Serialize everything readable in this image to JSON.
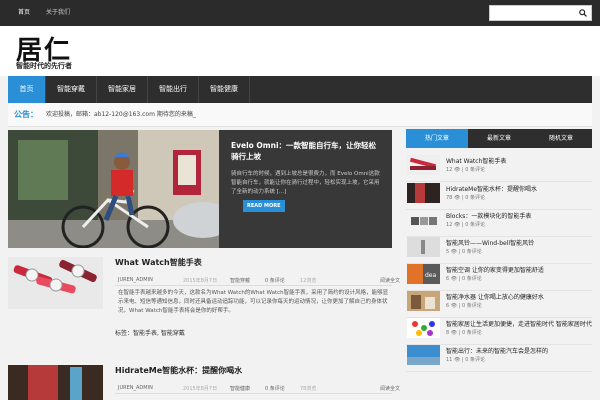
{
  "topnav": [
    "首页",
    "关于我们"
  ],
  "search": {
    "placeholder": ""
  },
  "logo": {
    "main": "居仁",
    "sub": "智能时代的先行者"
  },
  "mainnav": [
    "首页",
    "智能穿戴",
    "智能家居",
    "智能出行",
    "智能健康"
  ],
  "ticker": {
    "label": "公告：",
    "text": "欢迎投稿，邮箱：ab12-120@163.com 期待您的来稿_"
  },
  "featured": {
    "title": "Evelo Omni：一款智能自行车，让你轻松骑行上坡",
    "excerpt": "骑自行车的时候，遇到上坡总是很费力，而 Evelo Omni这款智能自行车，就能让你在骑行过程中，轻松实现上坡，它采用了全新的动力系统 [...]",
    "read_more": "READ MORE"
  },
  "posts": [
    {
      "title": "What Watch智能手表",
      "author": "JUREN_ADMIN",
      "date": "2015年8月7日",
      "category": "智能穿戴",
      "comments": "0 条评论",
      "views": "12浏览",
      "more": "阅读全文",
      "excerpt": "在智能手表越来越多的今天，这款名为What Watch的What Watch智能手表，采用了简约的设计风格，能够显示来电、短信等通知信息，同时还具备运动追踪功能，可以记录你每天的运动情况，让你更加了解自己的身体状况，What Watch智能手表将会是你的好帮手。",
      "tags": "标签：智能手表, 智能穿戴"
    },
    {
      "title": "HidrateMe智能水杯：提醒你喝水",
      "author": "JUREN_ADMIN",
      "date": "2015年8月7日",
      "category": "智能健康",
      "comments": "0 条评论",
      "views": "78浏览",
      "more": "阅读全文"
    }
  ],
  "sidebar": {
    "tabs": [
      "热门文章",
      "最新文章",
      "随机文章"
    ],
    "items": [
      {
        "title": "What Watch智能手表",
        "views": "12",
        "comments": "0 条评论"
      },
      {
        "title": "HidrateMe智能水杯：提醒你喝水",
        "views": "78",
        "comments": "0 条评论"
      },
      {
        "title": "Blocks：一款模块化的智能手表",
        "views": "12",
        "comments": "0 条评论"
      },
      {
        "title": "智能风铃——Wind-bell智能风铃",
        "views": "5",
        "comments": "0 条评论"
      },
      {
        "title": "智能空调 让你的家变得更加智能舒适",
        "views": "6",
        "comments": "0 条评论"
      },
      {
        "title": "智能净水器 让你喝上放心的健康好水",
        "views": "6",
        "comments": "0 条评论"
      },
      {
        "title": "智能家居让生活更加便捷，走进智能时代 智能家居时代",
        "views": "8",
        "comments": "0 条评论"
      },
      {
        "title": "智能出行：未来的智能汽车会是怎样的",
        "views": "11",
        "comments": "0 条评论"
      }
    ]
  }
}
